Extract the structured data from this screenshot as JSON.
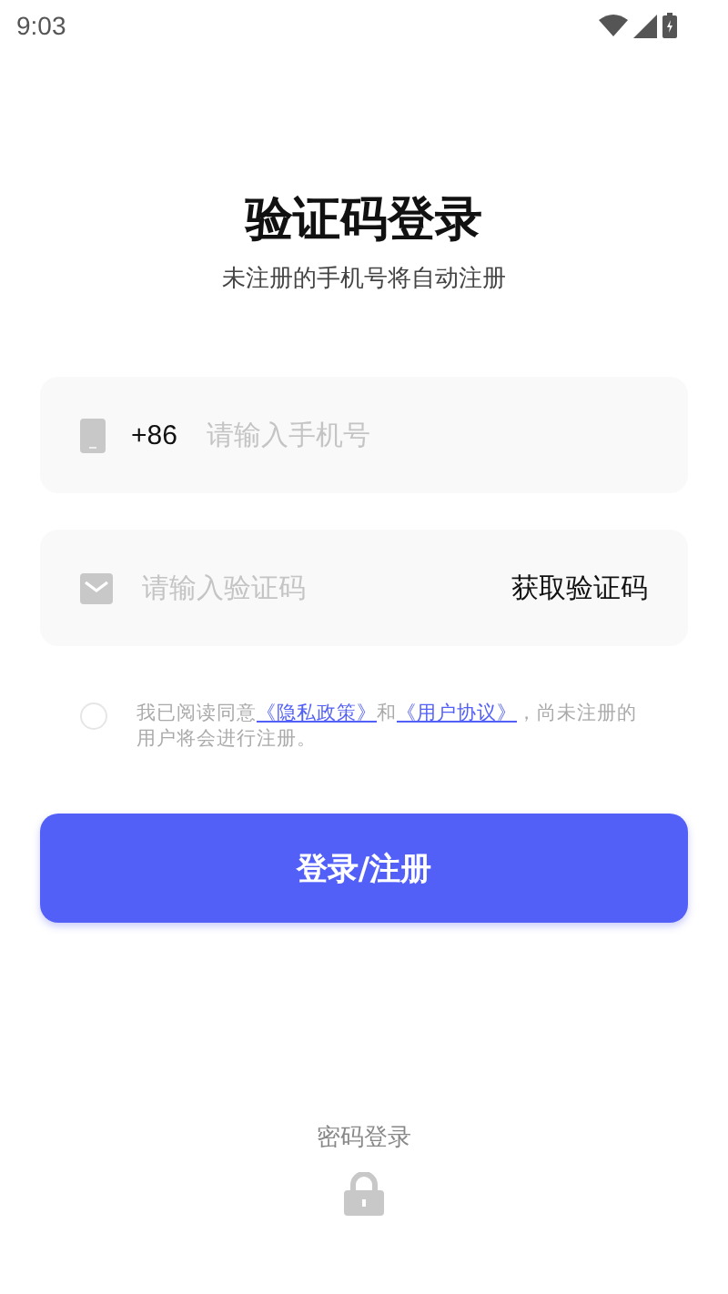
{
  "status_bar": {
    "time": "9:03"
  },
  "title": "验证码登录",
  "subtitle": "未注册的手机号将自动注册",
  "phone_field": {
    "prefix": "+86",
    "placeholder": "请输入手机号"
  },
  "code_field": {
    "placeholder": "请输入验证码",
    "action": "获取验证码"
  },
  "agreement": {
    "checked": false,
    "parts": [
      {
        "kind": "text",
        "text": "我已阅读同意"
      },
      {
        "kind": "link",
        "text": "《隐私政策》"
      },
      {
        "kind": "text",
        "text": "和"
      },
      {
        "kind": "link",
        "text": "《用户协议》"
      },
      {
        "kind": "text",
        "text": "，尚未注册的用户将会进行注册。"
      }
    ]
  },
  "login_button": "登录/注册",
  "password_login": "密码登录"
}
